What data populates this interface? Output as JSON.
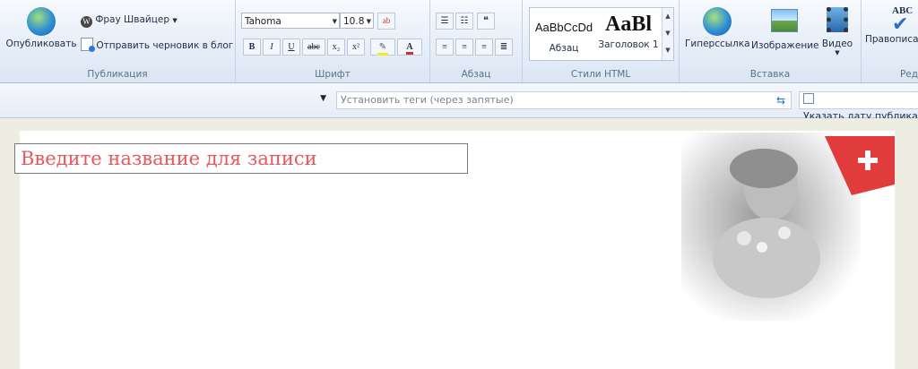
{
  "ribbon": {
    "publication": {
      "publish_label": "Опубликовать",
      "blog_name": "Фрау Швайцер",
      "send_draft_label": "Отправить черновик в блог",
      "group_label": "Публикация"
    },
    "font": {
      "font_name": "Tahoma",
      "font_size": "10.8",
      "bold": "B",
      "italic": "I",
      "underline": "U",
      "strike": "abc",
      "subscript": "x₂",
      "superscript": "x²",
      "font_color_letter": "A",
      "group_label": "Шрифт"
    },
    "paragraph": {
      "group_label": "Абзац"
    },
    "styles": {
      "items": [
        {
          "preview": "AaBbCcDd",
          "label": "Абзац"
        },
        {
          "preview": "AaBl",
          "label": "Заголовок 1"
        }
      ],
      "group_label": "Стили HTML"
    },
    "insert": {
      "hyperlink_label": "Гиперссылка",
      "image_label": "Изображение",
      "video_label": "Видео",
      "group_label": "Вставка"
    },
    "proofing": {
      "spelling_label": "Правописа",
      "abc": "ABC",
      "group_label": "Ред"
    }
  },
  "toolbar2": {
    "tags_placeholder": "Установить теги (через запятые)",
    "date_label": "Указать дату публика"
  },
  "editor": {
    "title_placeholder": "Введите название для записи"
  },
  "colors": {
    "ribbon_bg": "#e7eef8",
    "title_text": "#e8585a",
    "page_bg": "#ffffff"
  }
}
